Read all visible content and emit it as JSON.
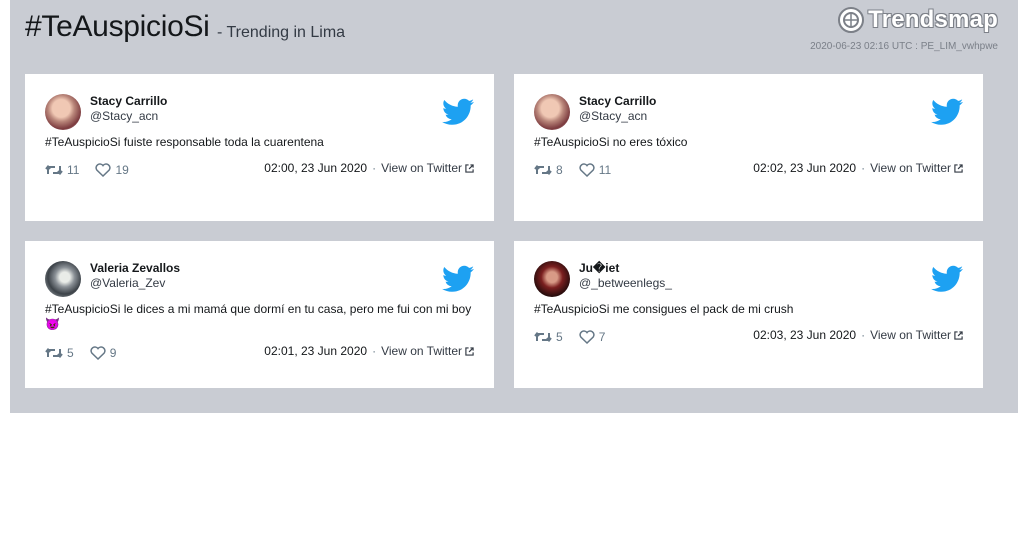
{
  "header": {
    "hashtag": "#TeAuspicioSi",
    "subtitle": "- Trending in Lima",
    "logo_text": "Trendsmap",
    "meta": "2020-06-23 02:16 UTC : PE_LIM_vwhpwe"
  },
  "colors": {
    "panel": "#c9ccd3",
    "twitter_blue": "#1da1f2",
    "muted": "#657786"
  },
  "tweets": [
    {
      "name": "Stacy Carrillo",
      "handle": "@Stacy_acn",
      "text": "#TeAuspicioSi fuiste responsable toda la cuarentena",
      "retweets": "11",
      "likes": "19",
      "time": "02:00, 23 Jun 2020",
      "link": "View on Twitter"
    },
    {
      "name": "Stacy Carrillo",
      "handle": "@Stacy_acn",
      "text": "#TeAuspicioSi no eres tóxico",
      "retweets": "8",
      "likes": "11",
      "time": "02:02, 23 Jun 2020",
      "link": "View on Twitter"
    },
    {
      "name": "Valeria Zevallos",
      "handle": "@Valeria_Zev",
      "text": "#TeAuspicioSi le dices a mi mamá que dormí en tu casa, pero me fui con mi boy 😈",
      "retweets": "5",
      "likes": "9",
      "time": "02:01, 23 Jun 2020",
      "link": "View on Twitter"
    },
    {
      "name": "Ju�iet",
      "handle": "@_betweenlegs_",
      "text": "#TeAuspicioSi me consigues el pack de mi crush",
      "retweets": "5",
      "likes": "7",
      "time": "02:03, 23 Jun 2020",
      "link": "View on Twitter"
    }
  ],
  "icons": [
    "trendsmap-logo-icon",
    "twitter-bird-icon",
    "retweet-icon",
    "heart-icon",
    "external-link-icon"
  ]
}
